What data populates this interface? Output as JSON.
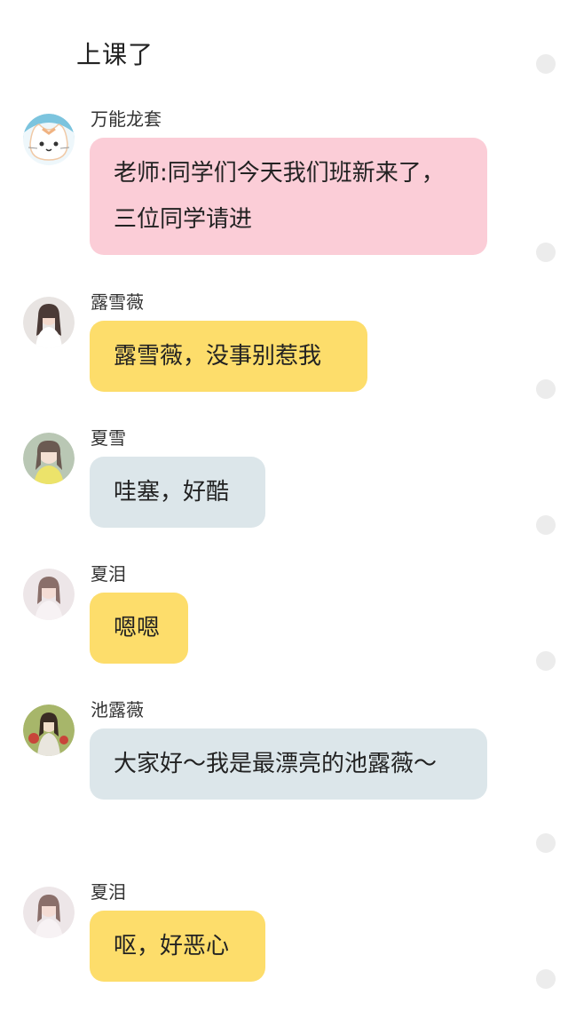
{
  "header": {
    "title": "上课了"
  },
  "messages": [
    {
      "name": "万能龙套",
      "text": "老师:同学们今天我们班新来了，三位同学请进",
      "color": "#fbcdd7",
      "avatar_icon": "cat-icon"
    },
    {
      "name": "露雪薇",
      "text": "露雪薇，没事别惹我",
      "color": "#fddd6b",
      "avatar_icon": "girl-photo-avatar"
    },
    {
      "name": "夏雪",
      "text": "哇塞，好酷",
      "color": "#dce6ea",
      "avatar_icon": "girl-photo-avatar"
    },
    {
      "name": "夏泪",
      "text": "嗯嗯",
      "color": "#fddd6b",
      "avatar_icon": "girl-photo-avatar"
    },
    {
      "name": "池露薇",
      "text": "大家好～我是最漂亮的池露薇～",
      "color": "#dce6ea",
      "avatar_icon": "girl-painting-avatar"
    },
    {
      "name": "夏泪",
      "text": "呕，好恶心",
      "color": "#fddd6b",
      "avatar_icon": "girl-photo-avatar"
    }
  ]
}
